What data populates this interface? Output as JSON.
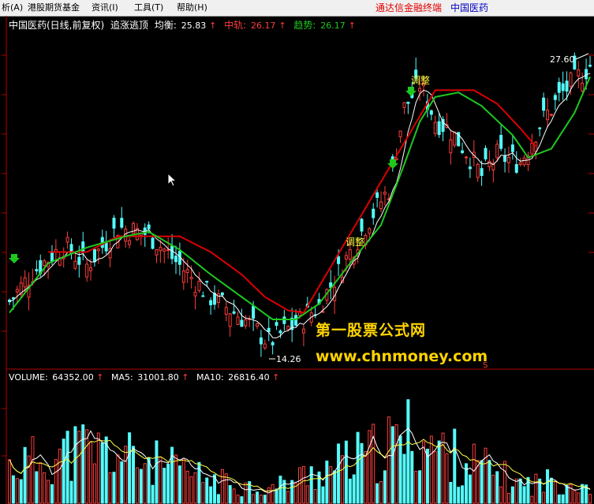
{
  "menu": {
    "items": [
      "析(A)",
      "港股期货基金",
      "资讯(I)",
      "工具(T)",
      "帮助(H)"
    ],
    "right_brand": "通达信金融终端",
    "right_stock": "中国医药"
  },
  "main_panel": {
    "title": "中国医药(日线,前复权)",
    "indicator_name": "追涨逃顶",
    "line1_label": "均衡:",
    "line1_value": "25.83",
    "line2_label": "中轨:",
    "line2_value": "26.17",
    "line3_label": "趋势:",
    "line3_value": "26.17",
    "high_label": "27.60",
    "low_label": "14.26",
    "annotation1": "调整",
    "annotation2": "调整",
    "s_marker": "S"
  },
  "volume_panel": {
    "volume_label": "VOLUME:",
    "volume_value": "64352.00",
    "ma5_label": "MA5:",
    "ma5_value": "31001.80",
    "ma10_label": "MA10:",
    "ma10_value": "26816.40"
  },
  "watermark": {
    "line1": "第一股票公式网",
    "line2": "www.chnmoney.com"
  },
  "colors": {
    "up": "#ff3c3c",
    "down": "#54fcfc",
    "trend_green": "#1ec81e",
    "mid_red": "#dc0000",
    "ma_white": "#ffffff",
    "brand_red": "#e00000",
    "brand_blue": "#0000c0"
  },
  "chart_data": {
    "type": "candlestick",
    "x_range_bars": [
      0,
      150
    ],
    "y_range": [
      13.4,
      28.0
    ],
    "price_key_points": [
      {
        "bar": 0,
        "close": 16.2
      },
      {
        "bar": 6,
        "close": 17.5
      },
      {
        "bar": 14,
        "close": 18.7
      },
      {
        "bar": 20,
        "close": 17.8
      },
      {
        "bar": 28,
        "close": 19.5
      },
      {
        "bar": 36,
        "close": 19.2
      },
      {
        "bar": 44,
        "close": 17.8
      },
      {
        "bar": 52,
        "close": 16.4
      },
      {
        "bar": 60,
        "close": 15.5
      },
      {
        "bar": 67,
        "close": 14.4
      },
      {
        "bar": 74,
        "close": 15.2
      },
      {
        "bar": 80,
        "close": 16.0
      },
      {
        "bar": 86,
        "close": 17.8
      },
      {
        "bar": 92,
        "close": 19.6
      },
      {
        "bar": 98,
        "close": 21.2
      },
      {
        "bar": 102,
        "close": 24.8
      },
      {
        "bar": 106,
        "close": 25.9
      },
      {
        "bar": 110,
        "close": 24.3
      },
      {
        "bar": 114,
        "close": 23.8
      },
      {
        "bar": 118,
        "close": 22.9
      },
      {
        "bar": 122,
        "close": 21.8
      },
      {
        "bar": 126,
        "close": 22.7
      },
      {
        "bar": 132,
        "close": 22.4
      },
      {
        "bar": 137,
        "close": 24.1
      },
      {
        "bar": 143,
        "close": 25.5
      },
      {
        "bar": 150,
        "close": 26.7
      }
    ],
    "trend_key_points": [
      {
        "bar": 0,
        "v": 15.7
      },
      {
        "bar": 10,
        "v": 17.9
      },
      {
        "bar": 20,
        "v": 18.6
      },
      {
        "bar": 30,
        "v": 19.1
      },
      {
        "bar": 36,
        "v": 19.3
      },
      {
        "bar": 44,
        "v": 18.5
      },
      {
        "bar": 52,
        "v": 17.4
      },
      {
        "bar": 60,
        "v": 16.4
      },
      {
        "bar": 68,
        "v": 15.4
      },
      {
        "bar": 74,
        "v": 15.4
      },
      {
        "bar": 80,
        "v": 16.1
      },
      {
        "bar": 88,
        "v": 17.9
      },
      {
        "bar": 96,
        "v": 19.6
      },
      {
        "bar": 102,
        "v": 22.3
      },
      {
        "bar": 106,
        "v": 24.2
      },
      {
        "bar": 110,
        "v": 25.3
      },
      {
        "bar": 116,
        "v": 25.5
      },
      {
        "bar": 122,
        "v": 24.9
      },
      {
        "bar": 130,
        "v": 23.6
      },
      {
        "bar": 134,
        "v": 22.6
      },
      {
        "bar": 140,
        "v": 23.0
      },
      {
        "bar": 146,
        "v": 24.6
      },
      {
        "bar": 150,
        "v": 26.2
      }
    ],
    "mid_key_points": [
      {
        "bar": 10,
        "v": 18.4
      },
      {
        "bar": 20,
        "v": 18.4
      },
      {
        "bar": 28,
        "v": 19.1
      },
      {
        "bar": 44,
        "v": 19.1
      },
      {
        "bar": 52,
        "v": 18.4
      },
      {
        "bar": 60,
        "v": 17.4
      },
      {
        "bar": 66,
        "v": 16.4
      },
      {
        "bar": 72,
        "v": 15.8
      },
      {
        "bar": 76,
        "v": 15.7
      },
      {
        "bar": 110,
        "v": 25.6
      },
      {
        "bar": 120,
        "v": 25.6
      },
      {
        "bar": 126,
        "v": 25.0
      },
      {
        "bar": 132,
        "v": 23.9
      },
      {
        "bar": 136,
        "v": 23.1
      }
    ],
    "volume_range": [
      0,
      130000
    ],
    "volume_key_points": [
      {
        "bar": 0,
        "v": 40000
      },
      {
        "bar": 20,
        "v": 60000
      },
      {
        "bar": 36,
        "v": 45000
      },
      {
        "bar": 52,
        "v": 25000
      },
      {
        "bar": 67,
        "v": 15000
      },
      {
        "bar": 80,
        "v": 35000
      },
      {
        "bar": 95,
        "v": 55000
      },
      {
        "bar": 104,
        "v": 75000
      },
      {
        "bar": 112,
        "v": 55000
      },
      {
        "bar": 122,
        "v": 40000
      },
      {
        "bar": 132,
        "v": 20000
      },
      {
        "bar": 142,
        "v": 25000
      },
      {
        "bar": 150,
        "v": 20000
      }
    ]
  }
}
